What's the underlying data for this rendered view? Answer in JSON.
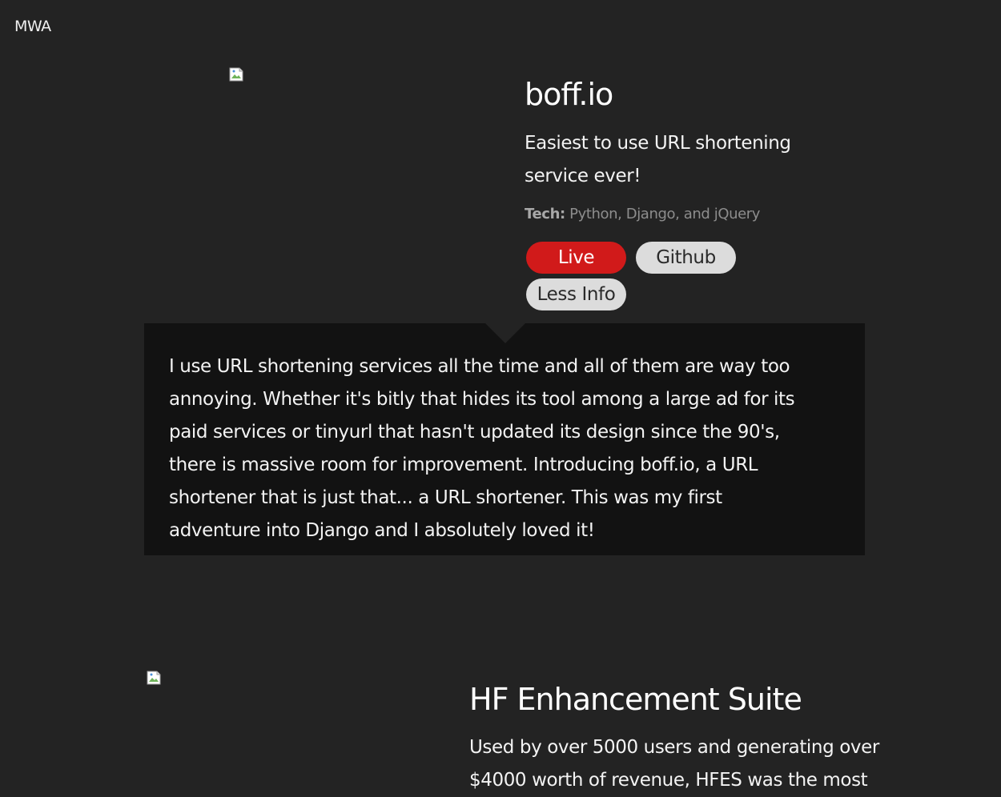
{
  "header": {
    "logo": "MWA"
  },
  "projects": [
    {
      "title": "boff.io",
      "tagline": "Easiest to use URL shortening service ever!",
      "tech_label": "Tech:",
      "tech_value": "Python, Django, and jQuery",
      "buttons": {
        "live": "Live",
        "github": "Github",
        "info": "Less Info"
      },
      "description": "I use URL shortening services all the time and all of them are way too annoying. Whether it's bitly that hides its tool among a large ad for its paid services or tinyurl that hasn't updated its design since the 90's, there is massive room for improvement. Introducing boff.io, a URL shortener that is just that... a URL shortener. This was my first adventure into Django and I absolutely loved it!"
    },
    {
      "title": "HF Enhancement Suite",
      "tagline": "Used by over 5000 users and generating over $4000 worth of revenue, HFES was the most"
    }
  ],
  "colors": {
    "background": "#232323",
    "panel": "#121212",
    "accent_live": "#d11a1a",
    "button_light": "#dcdcdc"
  }
}
